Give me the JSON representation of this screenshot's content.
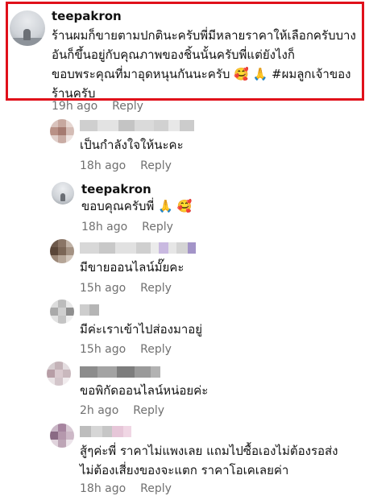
{
  "reply_label": "Reply",
  "main_comment": {
    "username": "teepakron",
    "text": "ร้านผมก็ขายตามปกตินะครับพี่มีหลายราคาให้เลือกครับบางอันก็ขึ้นอยู่กับคุณภาพของชิ้นนั้นครับพี่แต่ยังไงก็ขอบพระคุณที่มาอุดหนุนกันนะครับ 🥰 🙏 #ผมลูกเจ้าของร้านครับ",
    "lines": [
      "ร้านผมก็ขายตามปกตินะครับพี่มีหลายราคาให้เลือกครับบาง",
      "อันก็ขึ้นอยู่กับคุณภาพของชิ้นนั้นครับพี่แต่ยังไงก็",
      "ขอบพระคุณที่มาอุดหนุนกันนะครับ 🥰 🙏 #ผมลูกเจ้าของ",
      "ร้านครับ"
    ],
    "time": "19h ago"
  },
  "replies": [
    {
      "username": "",
      "text": "เป็นกำลังใจให้นะคะ",
      "time": "18h ago"
    },
    {
      "username": "teepakron",
      "text": "ขอบคุณครับพี่ 🙏 🥰",
      "time": "18h ago"
    },
    {
      "username": "",
      "text": "มีขายออนไลน์มั๊ยคะ",
      "time": "15h ago"
    },
    {
      "username": "",
      "text": "มีค่ะเราเข้าไปส่องมาอยู่",
      "time": "15h ago"
    },
    {
      "username": "",
      "text": "ขอพิกัดออนไลน์หน่อยค่ะ",
      "time": "2h ago"
    },
    {
      "username": "",
      "text": "สู้ๆค่ะพี่ ราคาไม่แพงเลย แถมไปซื้อเองไม่ต้องรอส่ง\nไม่ต้องเสี่ยงของจะแตก ราคาโอเคเลยค่า",
      "time": "18h ago"
    }
  ]
}
